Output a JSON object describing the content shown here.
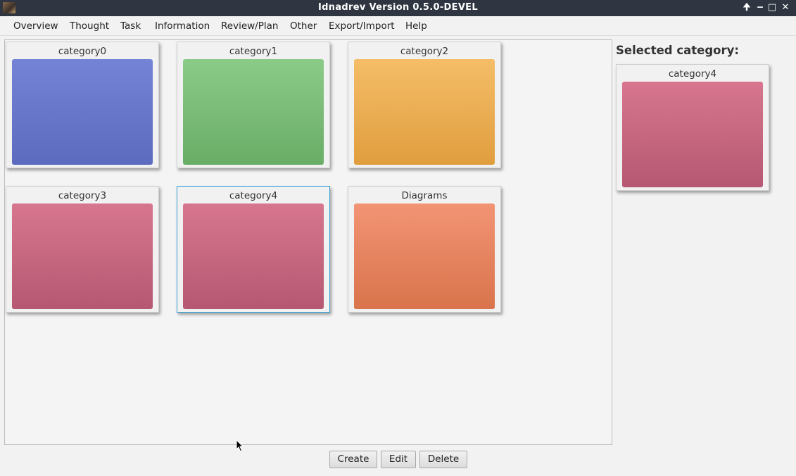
{
  "window": {
    "title": "Idnadrev Version 0.5.0-DEVEL",
    "controls": {
      "pin": "🠉",
      "minimize": "‒",
      "maximize": "□",
      "close": "✕"
    }
  },
  "menu": [
    "Overview",
    "Thought",
    "Task",
    "Information",
    "Review/Plan",
    "Other",
    "Export/Import",
    "Help"
  ],
  "categories": [
    {
      "name": "category0",
      "color_top": "#7483d6",
      "color_bottom": "#5d6bbf"
    },
    {
      "name": "category1",
      "color_top": "#8bcb88",
      "color_bottom": "#69ad67"
    },
    {
      "name": "category2",
      "color_top": "#f5bd68",
      "color_bottom": "#e09e3e"
    },
    {
      "name": "category3",
      "color_top": "#d7768e",
      "color_bottom": "#b65872"
    },
    {
      "name": "category4",
      "color_top": "#d7768e",
      "color_bottom": "#b65872"
    },
    {
      "name": "Diagrams",
      "color_top": "#f29474",
      "color_bottom": "#d9744c"
    }
  ],
  "selected_category": {
    "heading": "Selected category:",
    "name": "category4",
    "color_top": "#d7768e",
    "color_bottom": "#b65872"
  },
  "buttons": {
    "create": "Create",
    "edit": "Edit",
    "delete": "Delete"
  },
  "accent": "#3aa3d8"
}
